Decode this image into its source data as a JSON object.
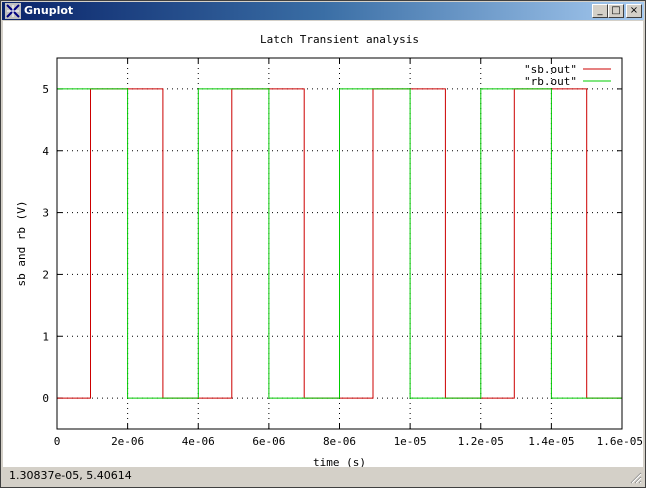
{
  "window": {
    "title": "Gnuplot",
    "min_label": "_",
    "max_label": "□",
    "close_label": "×"
  },
  "status": {
    "coords": "1.30837e-05,  5.40614"
  },
  "chart_data": {
    "type": "line",
    "title": "Latch Transient analysis",
    "xlabel": "time (s)",
    "ylabel": "sb and rb (V)",
    "xlim": [
      0,
      1.6e-05
    ],
    "ylim": [
      -0.5,
      5.5
    ],
    "grid": true,
    "legend_position": "top-right",
    "xticks": [
      {
        "v": 0,
        "label": "0"
      },
      {
        "v": 2e-06,
        "label": "2e-06"
      },
      {
        "v": 4e-06,
        "label": "4e-06"
      },
      {
        "v": 6e-06,
        "label": "6e-06"
      },
      {
        "v": 8e-06,
        "label": "8e-06"
      },
      {
        "v": 1e-05,
        "label": "1e-05"
      },
      {
        "v": 1.2e-05,
        "label": "1.2e-05"
      },
      {
        "v": 1.4e-05,
        "label": "1.4e-05"
      },
      {
        "v": 1.6e-05,
        "label": "1.6e-05"
      }
    ],
    "yticks": [
      {
        "v": 0,
        "label": "0"
      },
      {
        "v": 1,
        "label": "1"
      },
      {
        "v": 2,
        "label": "2"
      },
      {
        "v": 3,
        "label": "3"
      },
      {
        "v": 4,
        "label": "4"
      },
      {
        "v": 5,
        "label": "5"
      }
    ],
    "series": [
      {
        "name": "\"sb.out\"",
        "color": "#cc0000",
        "x": [
          0,
          9.5e-07,
          9.5e-07,
          3e-06,
          3e-06,
          4.95e-06,
          4.95e-06,
          7e-06,
          7e-06,
          8.95e-06,
          8.95e-06,
          1.1e-05,
          1.1e-05,
          1.295e-05,
          1.295e-05,
          1.5e-05,
          1.5e-05,
          1.6e-05
        ],
        "y": [
          0,
          0,
          5,
          5,
          0,
          0,
          5,
          5,
          0,
          0,
          5,
          5,
          0,
          0,
          5,
          5,
          0,
          0
        ]
      },
      {
        "name": "\"rb.out\"",
        "color": "#00cc00",
        "x": [
          0,
          2e-06,
          2e-06,
          4e-06,
          4e-06,
          6e-06,
          6e-06,
          8e-06,
          8e-06,
          1e-05,
          1e-05,
          1.2e-05,
          1.2e-05,
          1.4e-05,
          1.4e-05,
          1.6e-05
        ],
        "y": [
          5,
          5,
          0,
          0,
          5,
          5,
          0,
          0,
          5,
          5,
          0,
          0,
          5,
          5,
          0,
          0
        ]
      }
    ]
  }
}
